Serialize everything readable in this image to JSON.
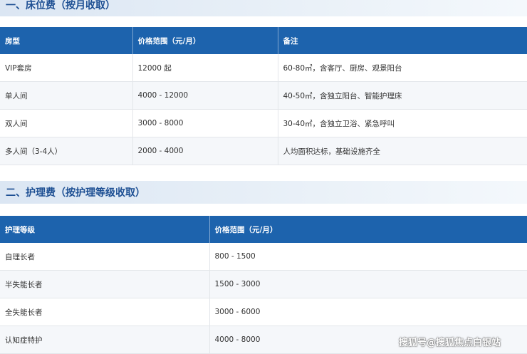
{
  "section1": {
    "title": "一、床位费（按月收取）"
  },
  "table1": {
    "headers": [
      "房型",
      "价格范围（元/月）",
      "备注"
    ],
    "rows": [
      [
        "VIP套房",
        "12000 起",
        "60-80㎡，含客厅、厨房、观景阳台"
      ],
      [
        "单人间",
        "4000 - 12000",
        "40-50㎡，含独立阳台、智能护理床"
      ],
      [
        "双人间",
        "3000 - 8000",
        "30-40㎡，含独立卫浴、紧急呼叫"
      ],
      [
        "多人间（3-4人）",
        "2000 - 4000",
        "人均面积达标，基础设施齐全"
      ]
    ]
  },
  "section2": {
    "title": "二、护理费（按护理等级收取）"
  },
  "table2": {
    "headers": [
      "护理等级",
      "价格范围（元/月）"
    ],
    "rows": [
      [
        "自理长者",
        "800 - 1500"
      ],
      [
        "半失能长者",
        "1500 - 3000"
      ],
      [
        "全失能长者",
        "3000 - 6000"
      ],
      [
        "认知症特护",
        "4000 - 8000"
      ]
    ]
  },
  "watermark": "搜狐号@搜狐焦点白银站"
}
